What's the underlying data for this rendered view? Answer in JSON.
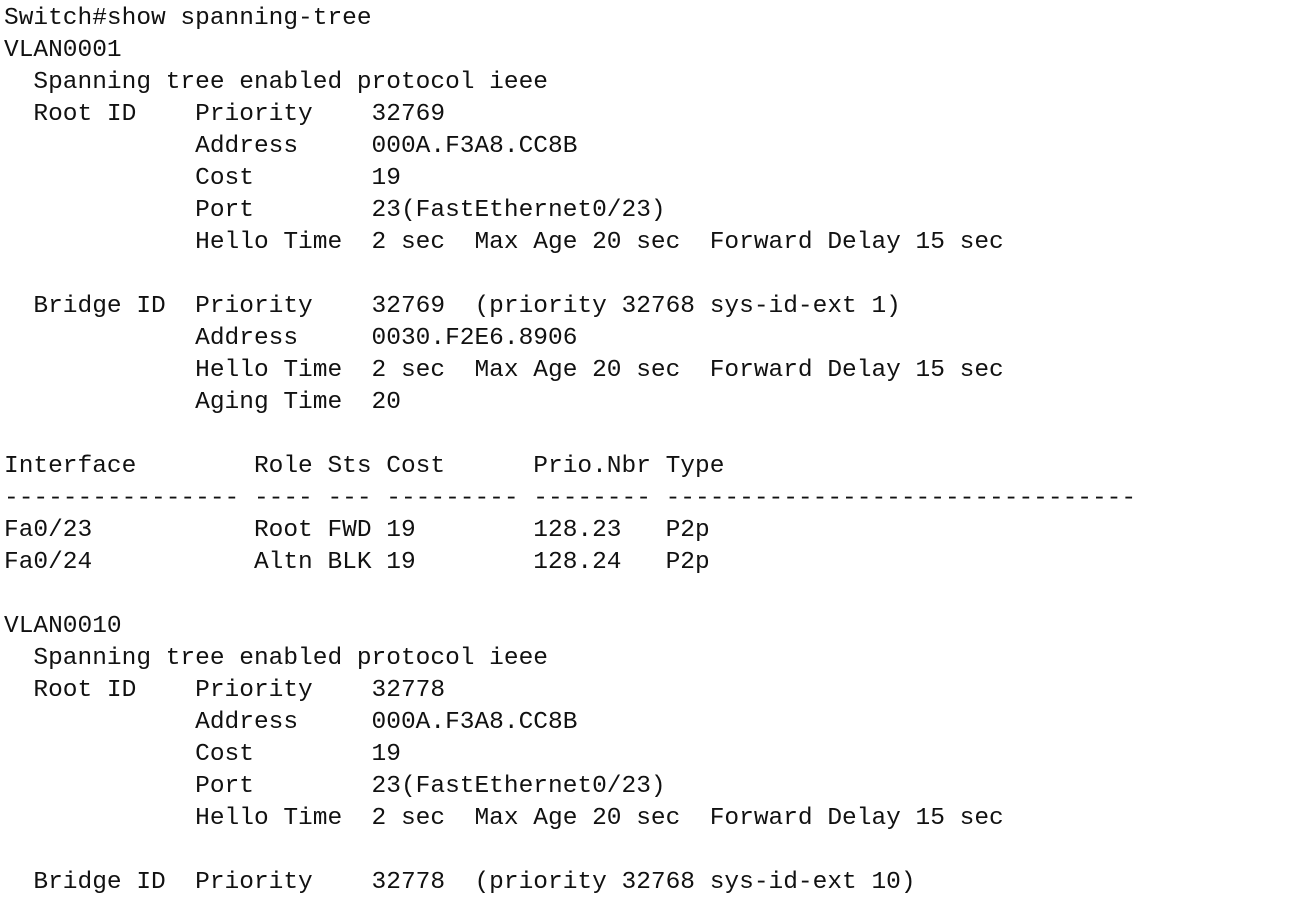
{
  "terminal": {
    "lines": [
      "Switch#show spanning-tree",
      "VLAN0001",
      "  Spanning tree enabled protocol ieee",
      "  Root ID    Priority    32769",
      "             Address     000A.F3A8.CC8B",
      "             Cost        19",
      "             Port        23(FastEthernet0/23)",
      "             Hello Time  2 sec  Max Age 20 sec  Forward Delay 15 sec",
      "",
      "  Bridge ID  Priority    32769  (priority 32768 sys-id-ext 1)",
      "             Address     0030.F2E6.8906",
      "             Hello Time  2 sec  Max Age 20 sec  Forward Delay 15 sec",
      "             Aging Time  20",
      "",
      "Interface        Role Sts Cost      Prio.Nbr Type",
      "---------------- ---- --- --------- -------- --------------------------------",
      "Fa0/23           Root FWD 19        128.23   P2p",
      "Fa0/24           Altn BLK 19        128.24   P2p",
      "",
      "VLAN0010",
      "  Spanning tree enabled protocol ieee",
      "  Root ID    Priority    32778",
      "             Address     000A.F3A8.CC8B",
      "             Cost        19",
      "             Port        23(FastEthernet0/23)",
      "             Hello Time  2 sec  Max Age 20 sec  Forward Delay 15 sec",
      "",
      "  Bridge ID  Priority    32778  (priority 32768 sys-id-ext 10)"
    ]
  }
}
